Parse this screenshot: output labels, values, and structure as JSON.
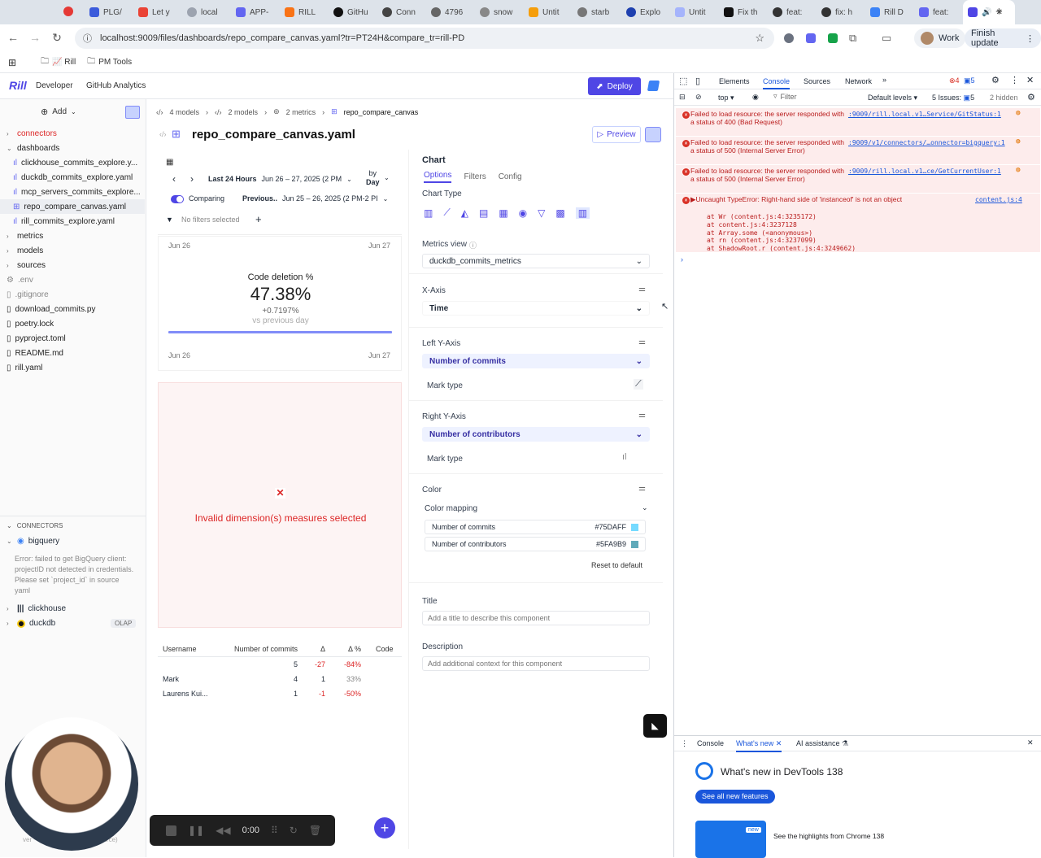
{
  "browser": {
    "tabs": [
      "PLG/",
      "Let y",
      "local",
      "APP-",
      "RILL",
      "GitHu",
      "Conn",
      "4796",
      "snow",
      "Untit",
      "starb",
      "Explo",
      "Untit",
      "Fix th",
      "feat:",
      "fix: h",
      "Rill D",
      "feat:",
      ""
    ],
    "url": "localhost:9009/files/dashboards/repo_compare_canvas.yaml?tr=PT24H&compare_tr=rill-PD",
    "profile": "Work",
    "finish_update": "Finish update",
    "bookmarks": [
      "Rill",
      "PM Tools"
    ]
  },
  "app": {
    "logo": "Rill",
    "crumb1": "Developer",
    "crumb2": "GitHub Analytics",
    "deploy": "Deploy"
  },
  "sidebar": {
    "add": "Add",
    "sections": {
      "connectors": "connectors",
      "dashboards": "dashboards",
      "metrics": "metrics",
      "models": "models",
      "sources": "sources"
    },
    "dashboards": [
      "clickhouse_commits_explore.y...",
      "duckdb_commits_explore.yaml",
      "mcp_servers_commits_explore...",
      "repo_compare_canvas.yaml",
      "rill_commits_explore.yaml"
    ],
    "files": [
      ".env",
      ".gitignore",
      "download_commits.py",
      "poetry.lock",
      "pyproject.toml",
      "README.md",
      "rill.yaml"
    ],
    "connectors_header": "CONNECTORS",
    "bigquery": "bigquery",
    "bigquery_error": "Error: failed to get BigQuery client: projectID not detected in credentials. Please set `project_id` in source yaml",
    "clickhouse": "clickhouse",
    "duckdb": "duckdb",
    "olap": "OLAP",
    "version_a": "ver",
    "version_b": "source)"
  },
  "editor": {
    "bc_models": "4 models",
    "bc_models2": "2 models",
    "bc_metrics": "2 metrics",
    "bc_current": "repo_compare_canvas",
    "title": "repo_compare_canvas.yaml",
    "preview": "Preview"
  },
  "canvas": {
    "range_label": "Last 24 Hours",
    "range_value": "Jun 26 – 27, 2025 (2 PM",
    "by": "by",
    "day": "Day",
    "comparing": "Comparing",
    "previous": "Previous..",
    "previous_value": "Jun 25 – 26, 2025 (2 PM-2 PI",
    "no_filters": "No filters selected",
    "axis_start": "Jun 26",
    "axis_end": "Jun 27",
    "kpi_title": "Code deletion %",
    "kpi_value": "47.38%",
    "kpi_delta": "+0.7197%",
    "kpi_vs": "vs previous day",
    "error_msg": "Invalid dimension(s) measures selected",
    "table": {
      "headers": [
        "Username",
        "Number of commits",
        "Δ",
        "Δ %",
        "Code"
      ],
      "rows": [
        [
          "",
          "5",
          "-27",
          "-84%"
        ],
        [
          "Mark",
          "4",
          "1",
          "33%"
        ],
        [
          "Laurens Kui...",
          "1",
          "-1",
          "-50%"
        ]
      ]
    },
    "recorder_time": "0:00"
  },
  "inspector": {
    "title": "Chart",
    "tabs": [
      "Options",
      "Filters",
      "Config"
    ],
    "chart_type": "Chart Type",
    "metrics_view_label": "Metrics view",
    "metrics_view": "duckdb_commits_metrics",
    "x_axis": "X-Axis",
    "x_value": "Time",
    "left_y": "Left Y-Axis",
    "left_value": "Number of commits",
    "mark_type": "Mark type",
    "right_y": "Right Y-Axis",
    "right_value": "Number of contributors",
    "color": "Color",
    "color_mapping": "Color mapping",
    "c1_name": "Number of commits",
    "c1_hex": "#75DAFF",
    "c2_name": "Number of contributors",
    "c2_hex": "#5FA9B9",
    "reset": "Reset to default",
    "title_label": "Title",
    "title_ph": "Add a title to describe this component",
    "desc_label": "Description",
    "desc_ph": "Add additional context for this component"
  },
  "devtools": {
    "tabs": [
      "Elements",
      "Console",
      "Sources",
      "Network"
    ],
    "err_count": "4",
    "msg_count": "5",
    "top": "top",
    "filter": "Filter",
    "levels": "Default levels",
    "issues": "5 Issues:",
    "issues_n": "5",
    "hidden": "2 hidden",
    "errors": [
      {
        "msg": "Failed to load resource: the server responded with a status of 400 (Bad Request)",
        "src": ":9009/rill.local.v1…Service/GitStatus:1"
      },
      {
        "msg": "Failed to load resource: the server responded with a status of 500 (Internal Server Error)",
        "src": ":9009/v1/connectors/…onnector=bigquery:1"
      },
      {
        "msg": "Failed to load resource: the server responded with a status of 500 (Internal Server Error)",
        "src": ":9009/rill.local.v1…ce/GetCurrentUser:1"
      }
    ],
    "uncaught": "▶Uncaught TypeError: Right-hand side of 'instanceof' is not an object",
    "uncaught_src": "content.js:4",
    "stack": [
      "at Wr (content.js:4:3235172)",
      "at content.js:4:3237128",
      "at Array.some (<anonymous>)",
      "at rn (content.js:4:3237099)",
      "at ShadowRoot.r (content.js:4:3249662)"
    ],
    "drawer_tabs": [
      "Console",
      "What's new",
      "AI assistance"
    ],
    "whats_new": "What's new in DevTools 138",
    "see_all": "See all new features",
    "highlights": "See the highlights from Chrome 138",
    "new_badge": "new"
  },
  "colors": {
    "accent": "#4f46e5",
    "error": "#dc2626",
    "c1": "#75DAFF",
    "c2": "#5FA9B9"
  }
}
